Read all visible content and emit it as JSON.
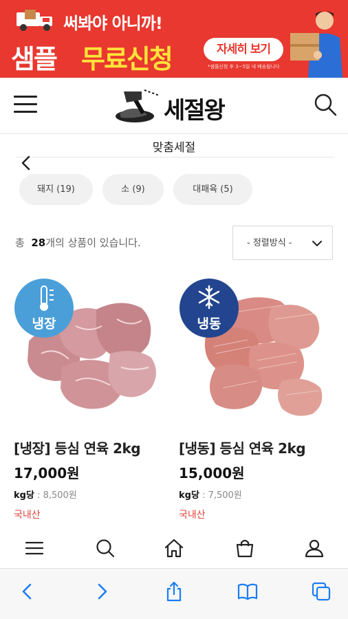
{
  "banner": {
    "line1": "써봐야 아니까!",
    "line2_a": "샘플",
    "line2_b": "무료신청",
    "button": "자세히 보기",
    "note": "*샘플신청 후 3~5일 내 배송됩니다"
  },
  "header": {
    "logo_text": "세절왕"
  },
  "section": {
    "title": "맞춤세절"
  },
  "chips": [
    {
      "label": "돼지 (19)"
    },
    {
      "label": "소 (9)"
    },
    {
      "label": "대패육 (5)"
    }
  ],
  "listing": {
    "count_prefix": "총",
    "count_value": "28",
    "count_suffix": "개의 상품이 있습니다.",
    "sort_label": "- 정렬방식 -"
  },
  "products": [
    {
      "badge": "냉장",
      "name": "[냉장] 등심 연육 2kg",
      "price": "17,000원",
      "unit_label": "kg당",
      "unit_price": ": 8,500원",
      "origin": "국내산"
    },
    {
      "badge": "냉동",
      "name": "[냉동] 등심 연육 2kg",
      "price": "15,000원",
      "unit_label": "kg당",
      "unit_price": ": 7,500원",
      "origin": "국내산"
    }
  ],
  "colors": {
    "banner_red": "#e8382f",
    "banner_yellow": "#ffe33a",
    "chilled_badge": "#4a9fd9",
    "frozen_badge": "#23458f",
    "origin_red": "#e0443a",
    "ios_blue": "#1a7cf5"
  },
  "icons": {
    "tabbar": [
      "menu-icon",
      "search-icon",
      "home-icon",
      "shopping-bag-icon",
      "user-icon"
    ],
    "browser": [
      "back-icon",
      "forward-icon",
      "share-icon",
      "bookmarks-icon",
      "tabs-icon"
    ]
  }
}
